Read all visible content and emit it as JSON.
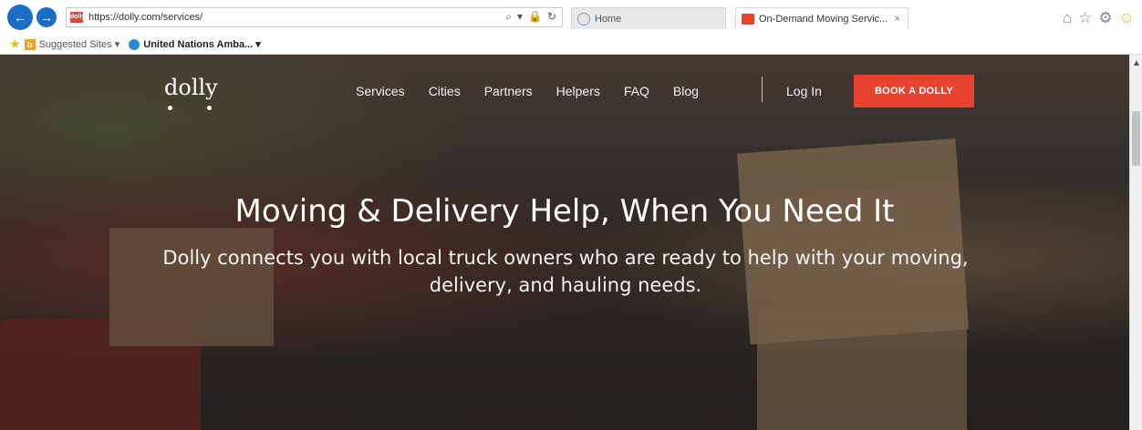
{
  "browser": {
    "url": "https://dolly.com/services/",
    "home_tab": "Home",
    "active_tab": "On-Demand Moving Servic...",
    "favorites": [
      {
        "label": "Suggested Sites ▾"
      },
      {
        "label": "United Nations Amba... ▾"
      }
    ]
  },
  "site": {
    "logo": "dolly",
    "nav": [
      "Services",
      "Cities",
      "Partners",
      "Helpers",
      "FAQ",
      "Blog"
    ],
    "login": "Log In",
    "cta": "BOOK A DOLLY"
  },
  "hero": {
    "title": "Moving & Delivery Help, When You Need It",
    "subtitle": "Dolly connects you with local truck owners who are ready to help with your moving, delivery, and hauling needs."
  },
  "colors": {
    "accent": "#e8432f",
    "browser_blue": "#1a6fc4"
  }
}
